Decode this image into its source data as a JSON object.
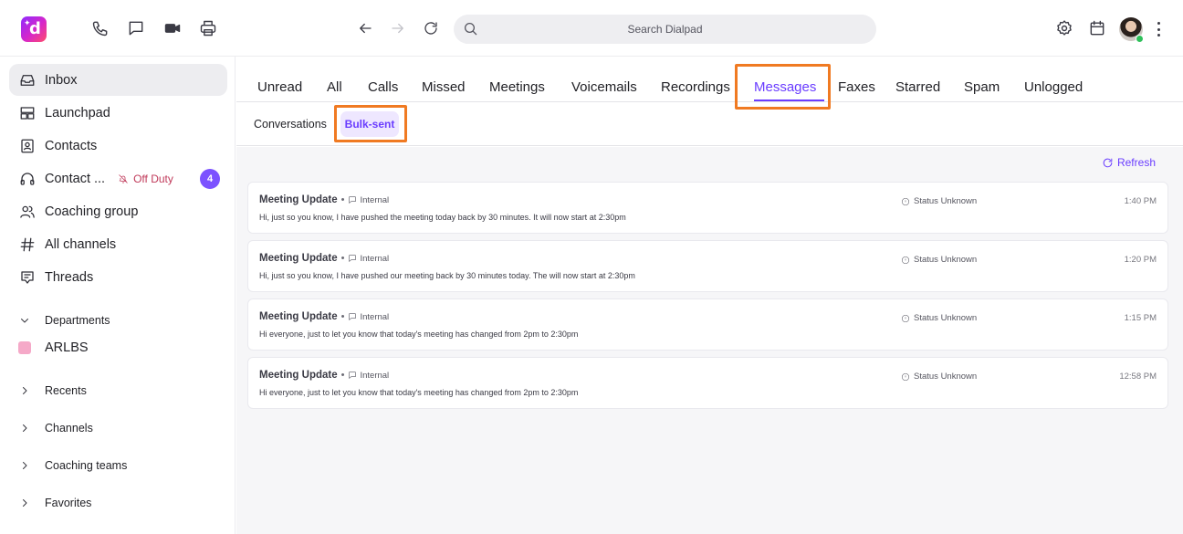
{
  "topbar": {
    "search_placeholder": "Search Dialpad",
    "icons": [
      "phone-icon",
      "chat-icon",
      "video-icon",
      "print-icon",
      "back-icon",
      "forward-icon",
      "reload-icon",
      "search-icon",
      "settings-icon",
      "calendar-icon"
    ]
  },
  "sidebar": {
    "items": [
      {
        "label": "Inbox",
        "icon": "inbox-icon",
        "active": true
      },
      {
        "label": "Launchpad",
        "icon": "launchpad-icon"
      },
      {
        "label": "Contacts",
        "icon": "contacts-icon"
      },
      {
        "label": "Contact ...",
        "icon": "headset-icon",
        "status": "Off Duty",
        "badge": "4"
      },
      {
        "label": "Coaching group",
        "icon": "group-icon"
      },
      {
        "label": "All channels",
        "icon": "hash-icon"
      },
      {
        "label": "Threads",
        "icon": "threads-icon"
      }
    ],
    "departments": {
      "label": "Departments",
      "items": [
        {
          "label": "ARLBS",
          "color": "#f5a9c8"
        }
      ]
    },
    "sections": [
      "Recents",
      "Channels",
      "Coaching teams",
      "Favorites"
    ]
  },
  "main": {
    "tabs": [
      "Unread",
      "All",
      "Calls",
      "Missed",
      "Meetings",
      "Voicemails",
      "Recordings",
      "Messages",
      "Faxes",
      "Starred",
      "Spam",
      "Unlogged"
    ],
    "active_tab": "Messages",
    "subtabs": [
      "Conversations",
      "Bulk-sent"
    ],
    "active_subtab": "Bulk-sent",
    "refresh_label": "Refresh",
    "messages": [
      {
        "title": "Meeting Update",
        "tag": "Internal",
        "body": "Hi, just so you know, I have pushed the meeting today back by 30 minutes. It will now start at 2:30pm",
        "status": "Status Unknown",
        "time": "1:40 PM"
      },
      {
        "title": "Meeting Update",
        "tag": "Internal",
        "body": "Hi, just so you know, I have pushed our meeting back by 30 minutes today. The will now start at 2:30pm",
        "status": "Status Unknown",
        "time": "1:20 PM"
      },
      {
        "title": "Meeting Update",
        "tag": "Internal",
        "body": "Hi everyone, just to let you know that today's meeting has changed from 2pm to 2:30pm",
        "status": "Status Unknown",
        "time": "1:15 PM"
      },
      {
        "title": "Meeting Update",
        "tag": "Internal",
        "body": "Hi everyone, just to let you know that today's meeting has changed from 2pm to 2:30pm",
        "status": "Status Unknown",
        "time": "12:58 PM"
      }
    ]
  },
  "colors": {
    "accent": "#6a3dff",
    "highlight": "#f07a22",
    "off_duty": "#c03a5a",
    "badge": "#7c52ff"
  }
}
